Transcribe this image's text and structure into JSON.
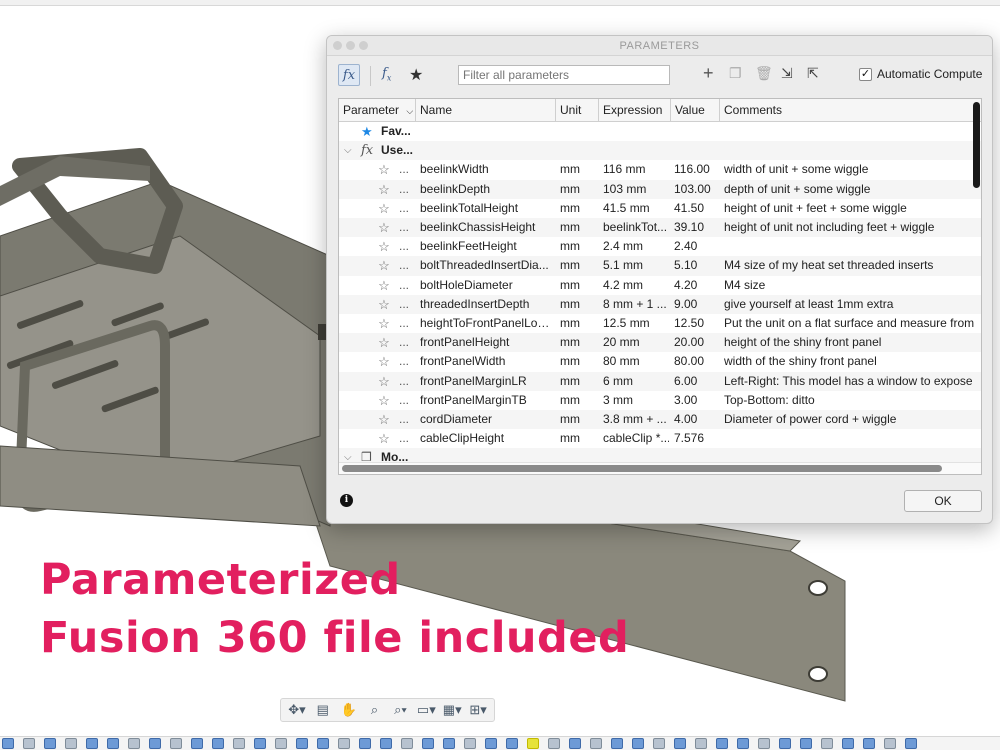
{
  "dialog": {
    "title": "PARAMETERS",
    "filter_placeholder": "Filter all parameters",
    "auto_compute_label": "Automatic Compute",
    "auto_compute_checked": true,
    "ok_label": "OK"
  },
  "table": {
    "headers": {
      "parameter": "Parameter",
      "name": "Name",
      "unit": "Unit",
      "expression": "Expression",
      "value": "Value",
      "comments": "Comments"
    },
    "groups": {
      "favorites": "Fav...",
      "user": "Use...",
      "model": "Mo..."
    },
    "rows": [
      {
        "name": "beelinkWidth",
        "unit": "mm",
        "expression": "116 mm",
        "value": "116.00",
        "comment": "width of unit + some wiggle"
      },
      {
        "name": "beelinkDepth",
        "unit": "mm",
        "expression": "103 mm",
        "value": "103.00",
        "comment": "depth of unit + some wiggle"
      },
      {
        "name": "beelinkTotalHeight",
        "unit": "mm",
        "expression": "41.5 mm",
        "value": "41.50",
        "comment": "height of unit + feet + some wiggle"
      },
      {
        "name": "beelinkChassisHeight",
        "unit": "mm",
        "expression": "beelinkTot...",
        "value": "39.10",
        "comment": "height of unit not including feet + wiggle"
      },
      {
        "name": "beelinkFeetHeight",
        "unit": "mm",
        "expression": "2.4 mm",
        "value": "2.40",
        "comment": ""
      },
      {
        "name": "boltThreadedInsertDia...",
        "unit": "mm",
        "expression": "5.1 mm",
        "value": "5.10",
        "comment": "M4 size of my heat set threaded inserts"
      },
      {
        "name": "boltHoleDiameter",
        "unit": "mm",
        "expression": "4.2 mm",
        "value": "4.20",
        "comment": "M4 size"
      },
      {
        "name": "threadedInsertDepth",
        "unit": "mm",
        "expression": "8 mm + 1 ...",
        "value": "9.00",
        "comment": "give yourself at least 1mm extra"
      },
      {
        "name": "heightToFrontPanelLow...",
        "unit": "mm",
        "expression": "12.5 mm",
        "value": "12.50",
        "comment": "Put the unit on a flat surface and measure from"
      },
      {
        "name": "frontPanelHeight",
        "unit": "mm",
        "expression": "20 mm",
        "value": "20.00",
        "comment": "height of the shiny front panel"
      },
      {
        "name": "frontPanelWidth",
        "unit": "mm",
        "expression": "80 mm",
        "value": "80.00",
        "comment": "width of the shiny front panel"
      },
      {
        "name": "frontPanelMarginLR",
        "unit": "mm",
        "expression": "6 mm",
        "value": "6.00",
        "comment": "Left-Right: This model has a window to expose"
      },
      {
        "name": "frontPanelMarginTB",
        "unit": "mm",
        "expression": "3 mm",
        "value": "3.00",
        "comment": "Top-Bottom: ditto"
      },
      {
        "name": "cordDiameter",
        "unit": "mm",
        "expression": "3.8 mm + ...",
        "value": "4.00",
        "comment": "Diameter of power cord + wiggle"
      },
      {
        "name": "cableClipHeight",
        "unit": "mm",
        "expression": "cableClip *...",
        "value": "7.576",
        "comment": ""
      }
    ]
  },
  "overlay": {
    "line1": "Parameterized",
    "line2": "Fusion 360 file included"
  },
  "colors": {
    "headline": "#e21f5f",
    "model_gray": "#8a887c",
    "favorite_star": "#1e88e5"
  }
}
